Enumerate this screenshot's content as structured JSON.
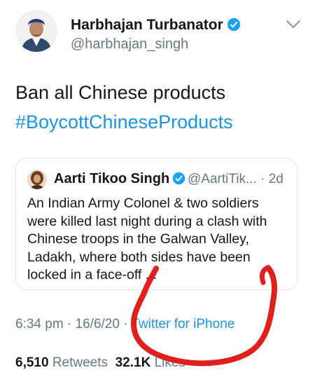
{
  "author": {
    "display_name": "Harbhajan Turbanator",
    "handle": "@harbhajan_singh",
    "avatar_icon": "profile-photo",
    "verified": true
  },
  "tweet": {
    "line1": "Ban all Chinese products",
    "hashtag": "#BoycottChineseProducts"
  },
  "quoted": {
    "display_name": "Aarti Tikoo Singh",
    "handle_time": "@AartiTik... · 2d",
    "text": "An Indian Army Colonel & two soldiers were killed last night during a clash with Chinese troops in the Galwan Valley, Ladakh, where both sides have been locked in a face-off ..."
  },
  "meta": {
    "time_date": "6:34 pm · 16/6/20 · ",
    "source": "Twitter for iPhone"
  },
  "stats": {
    "retweets_count": "6,510",
    "retweets_label": "Retweets",
    "likes_count": "32.1K",
    "likes_label": "Likes"
  },
  "colors": {
    "link_blue": "#1b95e0",
    "verified_blue": "#1da1f2",
    "annotation_red": "#e0201b"
  }
}
